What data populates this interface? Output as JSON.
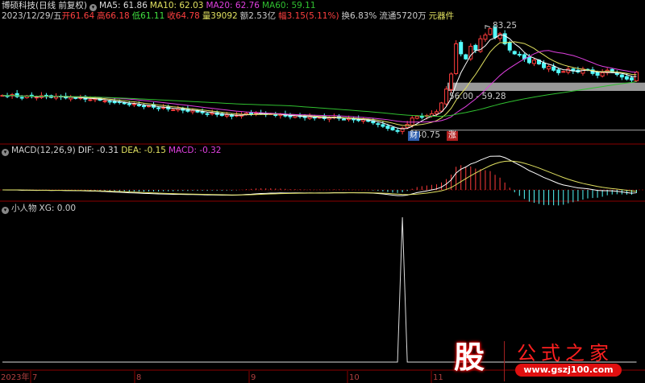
{
  "header": {
    "title": "博硕科技(日线 前复权)",
    "ma5": "MA5: 61.86",
    "ma10": "MA10: 62.03",
    "ma20": "MA20: 62.76",
    "ma60": "MA60: 59.11",
    "date": "2023/12/29/五",
    "open": "开61.64",
    "high": "高66.18",
    "low": "低61.11",
    "close": "收64.78",
    "volume": "量39092",
    "amount": "额2.53亿",
    "change": "幅3.15(5.11%)",
    "turnover": "换6.83%",
    "float": "流通5720万",
    "sector": "元器件"
  },
  "macd_header": {
    "name": "MACD(12,26,9)",
    "dif": "DIF: -0.31",
    "dea": "DEA: -0.15",
    "macd": "MACD: -0.32"
  },
  "xg_header": {
    "name": "小人物",
    "xg": "XG: 0.00"
  },
  "annotations": {
    "high": "83.25",
    "low": "40.75",
    "band": "56.00 - 59.28",
    "badge_cai": "财",
    "badge_zhang": "涨"
  },
  "axis": {
    "labels": [
      "2023年",
      "7",
      "8",
      "9",
      "10",
      "11"
    ]
  },
  "logo": {
    "char": "股",
    "name": "公式之家",
    "url": "www.gszj100.com"
  },
  "colors": {
    "up": "#ff3c3c",
    "down": "#54fcfc",
    "ma5": "#ffffff",
    "ma10": "#e0e060",
    "ma20": "#e040e0",
    "ma60": "#30c030",
    "grid": "#8b0000"
  },
  "chart_data": {
    "type": "candlestick",
    "price_range": [
      36.5,
      87
    ],
    "high_label": 83.25,
    "low_label": 40.75,
    "band": [
      56.0,
      59.28
    ],
    "closes": [
      55.5,
      55.2,
      55.8,
      55.0,
      54.6,
      55.3,
      55.1,
      54.8,
      55.4,
      55.0,
      54.7,
      55.2,
      54.9,
      54.5,
      54.8,
      54.3,
      54.6,
      54.0,
      53.8,
      54.2,
      53.6,
      53.3,
      53.0,
      52.6,
      52.9,
      52.2,
      51.8,
      52.1,
      51.5,
      51.0,
      51.3,
      50.8,
      50.4,
      50.7,
      50.1,
      49.8,
      50.2,
      49.6,
      49.2,
      49.5,
      48.9,
      48.6,
      48.2,
      48.5,
      47.9,
      47.5,
      47.8,
      47.2,
      47.6,
      48.0,
      48.4,
      48.1,
      48.6,
      48.3,
      47.9,
      48.2,
      47.6,
      47.9,
      47.3,
      47.0,
      47.4,
      47.1,
      46.7,
      47.0,
      46.5,
      46.8,
      46.3,
      46.6,
      46.9,
      46.4,
      46.0,
      46.3,
      45.8,
      45.5,
      45.9,
      45.2,
      44.6,
      44.0,
      43.2,
      42.4,
      41.8,
      41.2,
      42.5,
      44.0,
      46.5,
      47.2,
      46.8,
      47.5,
      48.2,
      49.0,
      52.5,
      58.0,
      64.0,
      76.0,
      72.0,
      70.0,
      75.0,
      73.5,
      78.0,
      79.5,
      82.0,
      78.5,
      80.0,
      76.0,
      73.5,
      72.0,
      71.5,
      70.0,
      68.5,
      69.5,
      68.0,
      66.5,
      67.0,
      65.5,
      64.5,
      65.0,
      66.0,
      65.2,
      64.8,
      66.0,
      65.5,
      64.2,
      63.5,
      64.5,
      65.5,
      64.8,
      63.8,
      62.8,
      62.0,
      61.6,
      64.78
    ],
    "xg_signal_bar": 82,
    "macd_params": [
      12,
      26,
      9
    ],
    "ma_periods": [
      5,
      10,
      20,
      60
    ]
  }
}
